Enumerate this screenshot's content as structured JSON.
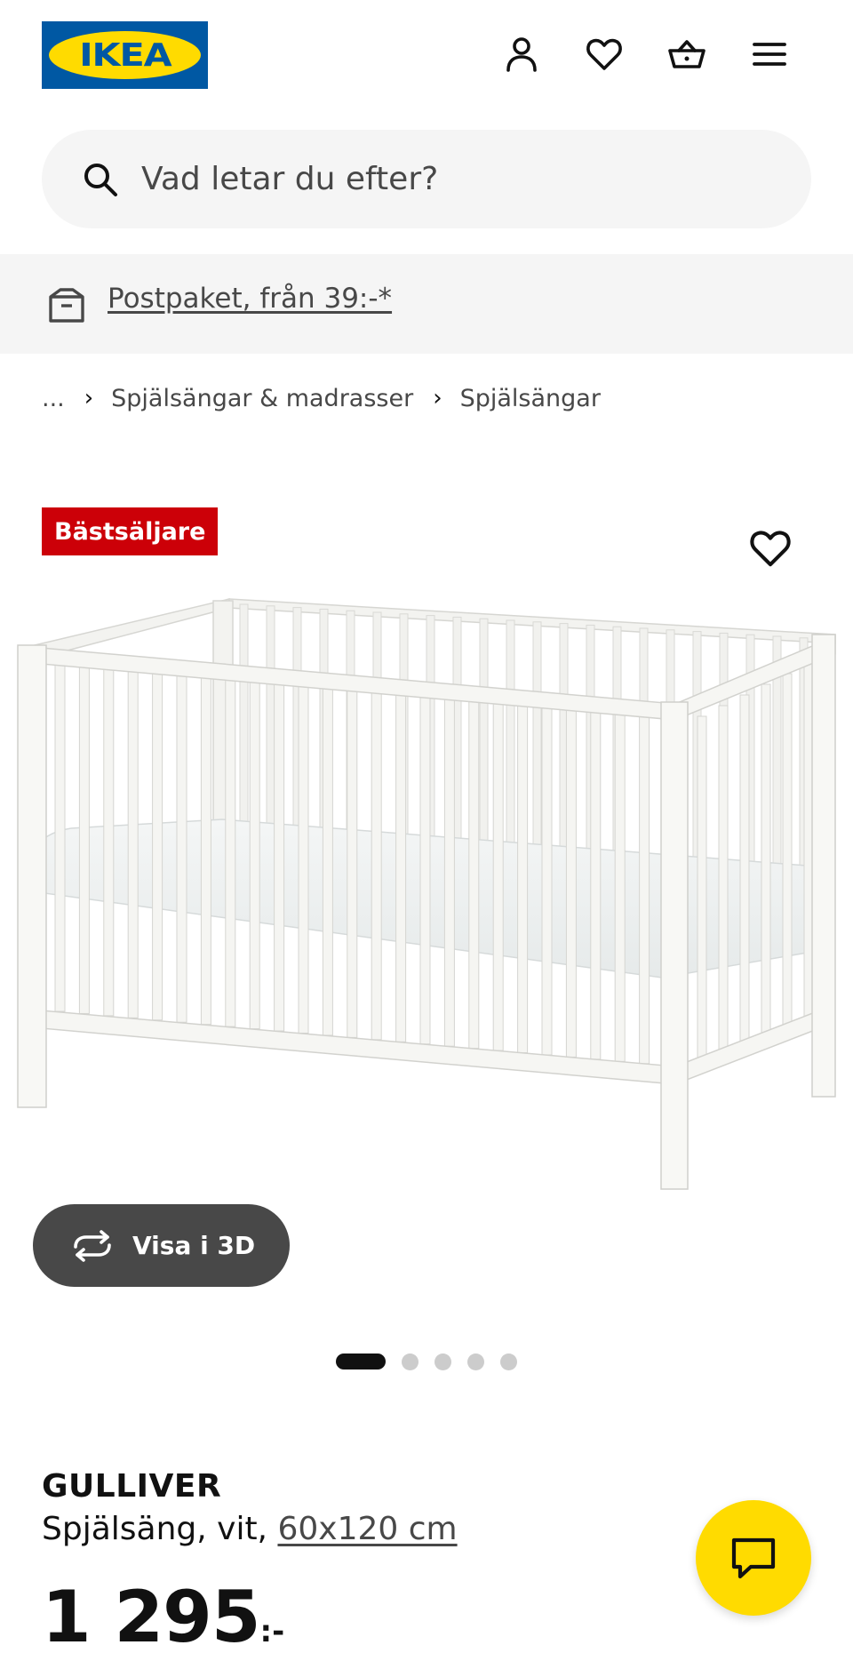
{
  "header": {
    "logo_text": "IKEA",
    "icons": [
      "user-icon",
      "heart-icon",
      "shopping-bag-icon",
      "hamburger-menu-icon"
    ]
  },
  "search": {
    "placeholder": "Vad letar du efter?"
  },
  "promo": {
    "link_text": "Postpaket, från 39:-*"
  },
  "breadcrumb": {
    "ellipsis": "...",
    "separator": "›",
    "items": [
      "Spjälsängar & madrasser",
      "Spjälsängar"
    ]
  },
  "product": {
    "badge": "Bästsäljare",
    "view_3d_label": "Visa i 3D",
    "image_count": 5,
    "active_image_index": 0,
    "name": "GULLIVER",
    "description_prefix": "Spjälsäng, vit, ",
    "size_link": "60x120 cm",
    "price_value": "1 295",
    "price_suffix": ":-"
  },
  "colors": {
    "ikea_blue": "#0058a3",
    "ikea_yellow": "#ffdb00",
    "badge_red": "#cc0008",
    "dark_gray": "#484848",
    "light_gray": "#f5f5f5"
  }
}
